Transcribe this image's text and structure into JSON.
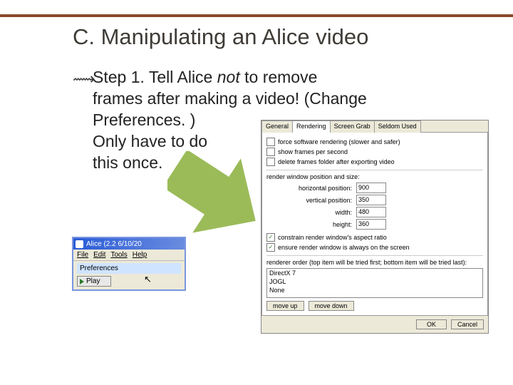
{
  "header": {
    "title": "C. Manipulating an Alice video"
  },
  "body": {
    "bullet_glyph": "⟿",
    "text_before_not": "Step 1. Tell Alice ",
    "not": "not",
    "text_line1_after_not": " to remove",
    "text_line2": "frames after making a video! (Change",
    "text_line3": "Preferences. )",
    "text_line4": "Only have to do",
    "text_line5": "this once."
  },
  "alice": {
    "titlebar": "Alice (2.2   6/10/20",
    "menu": {
      "file": "File",
      "edit": "Edit",
      "tools": "Tools",
      "help": "Help"
    },
    "preferences_item": "Preferences",
    "play": "Play"
  },
  "pref": {
    "tabs": {
      "general": "General",
      "rendering": "Rendering",
      "screengrab": "Screen Grab",
      "seldom": "Seldom Used"
    },
    "force_soft": "force software rendering (slower and safer)",
    "show_fps": "show frames per second",
    "delete_frames": "delete frames folder after exporting video",
    "section_size": "render window position and size:",
    "rows": {
      "hpos": {
        "label": "horizontal position:",
        "value": "900"
      },
      "vpos": {
        "label": "vertical position:",
        "value": "350"
      },
      "width": {
        "label": "width:",
        "value": "480"
      },
      "height": {
        "label": "height:",
        "value": "360"
      }
    },
    "constrain": "constrain render window's aspect ratio",
    "ensure": "ensure render window is always on the screen",
    "section_order": "renderer order (top item will be tried first; bottom item will be tried last):",
    "order_items": {
      "dx7": "DirectX 7",
      "jogl": "JOGL",
      "none": "None"
    },
    "moveup": "move up",
    "movedown": "move down",
    "ok": "OK",
    "cancel": "Cancel"
  }
}
